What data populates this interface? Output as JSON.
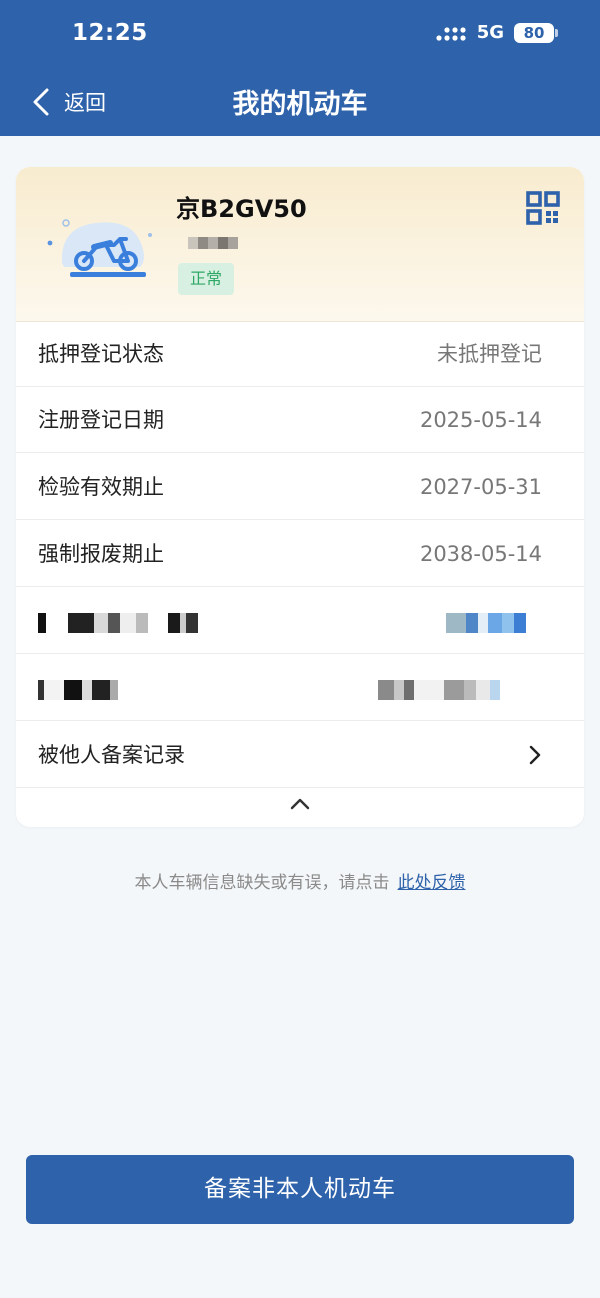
{
  "status_bar": {
    "time": "12:25",
    "network": "5G",
    "battery": "80"
  },
  "header": {
    "back_label": "返回",
    "title": "我的机动车"
  },
  "vehicle": {
    "plate": "京B2GV50",
    "status": "正常"
  },
  "info_rows": [
    {
      "label": "抵押登记状态",
      "value": "未抵押登记"
    },
    {
      "label": "注册登记日期",
      "value": "2025-05-14"
    },
    {
      "label": "检验有效期止",
      "value": "2027-05-31"
    },
    {
      "label": "强制报废期止",
      "value": "2038-05-14"
    }
  ],
  "record_row": {
    "label": "被他人备案记录"
  },
  "feedback": {
    "text": "本人车辆信息缺失或有误，请点击",
    "link": "此处反馈"
  },
  "bottom_button": {
    "label": "备案非本人机动车"
  },
  "colors": {
    "primary": "#2e62aa",
    "status_green": "#2ea866",
    "badge_bg": "#d8f0e1"
  },
  "icons": [
    "signal-icon",
    "back-chevron-icon",
    "motorcycle-icon",
    "qr-code-icon",
    "chevron-right-icon",
    "chevron-up-icon"
  ]
}
